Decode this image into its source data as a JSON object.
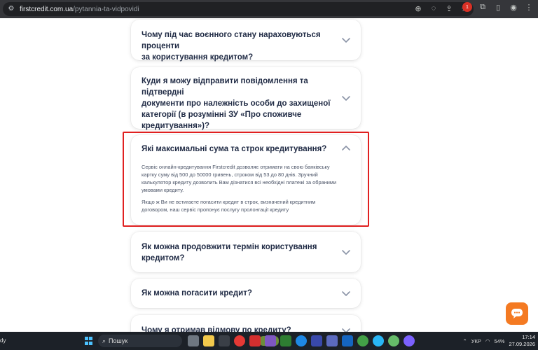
{
  "browser": {
    "url_host": "firstcredit.com.ua",
    "url_path": "/pytannia-ta-vidpovidi"
  },
  "faq": [
    {
      "question_lines": [
        "Чому під час воєнного стану нараховуються проценти",
        "за користування кредитом?"
      ],
      "expanded": false
    },
    {
      "question_lines": [
        "Куди я можу відправити повідомлення та підтвердні",
        "документи про належність особи до захищеної",
        "категорії (в розумінні ЗУ «Про споживче",
        "кредитування»)?"
      ],
      "expanded": false
    },
    {
      "question_lines": [
        "Які максимальні сума та строк кредитування?"
      ],
      "expanded": true,
      "answer_p1_lines": [
        "Сервіс онлайн-кредитування Firstcredit дозволяє отримати на свою банківську",
        "картку суму від 500 до 50000 гривень, строком від 53 до 80 днів. Зручний",
        "калькулятор кредиту дозволить Вам дізнатися всі необхідні платежі за обраними",
        "умовами кредиту."
      ],
      "answer_p2_lines": [
        "Якщо ж Ви не встигаєте погасити кредит в строк, визначений кредитним",
        "договором, наш сервіс пропонує послугу пролонгації кредиту"
      ]
    },
    {
      "question_lines": [
        "Як можна продовжити термін користування",
        "кредитом?"
      ],
      "expanded": false
    },
    {
      "question_lines": [
        "Як можна погасити кредит?"
      ],
      "expanded": false
    },
    {
      "question_lines": [
        "Чому я отримав відмову по кредиту?"
      ],
      "expanded": false
    }
  ],
  "taskbar": {
    "weather_text": "dy",
    "search_placeholder": "Пошук",
    "language": "УКР",
    "battery": "54%",
    "time": "17:14",
    "date": "27.09.2026"
  },
  "colors": {
    "highlight": "#e02020",
    "chat_button": "#f47a22",
    "question_text": "#1f2a44"
  }
}
